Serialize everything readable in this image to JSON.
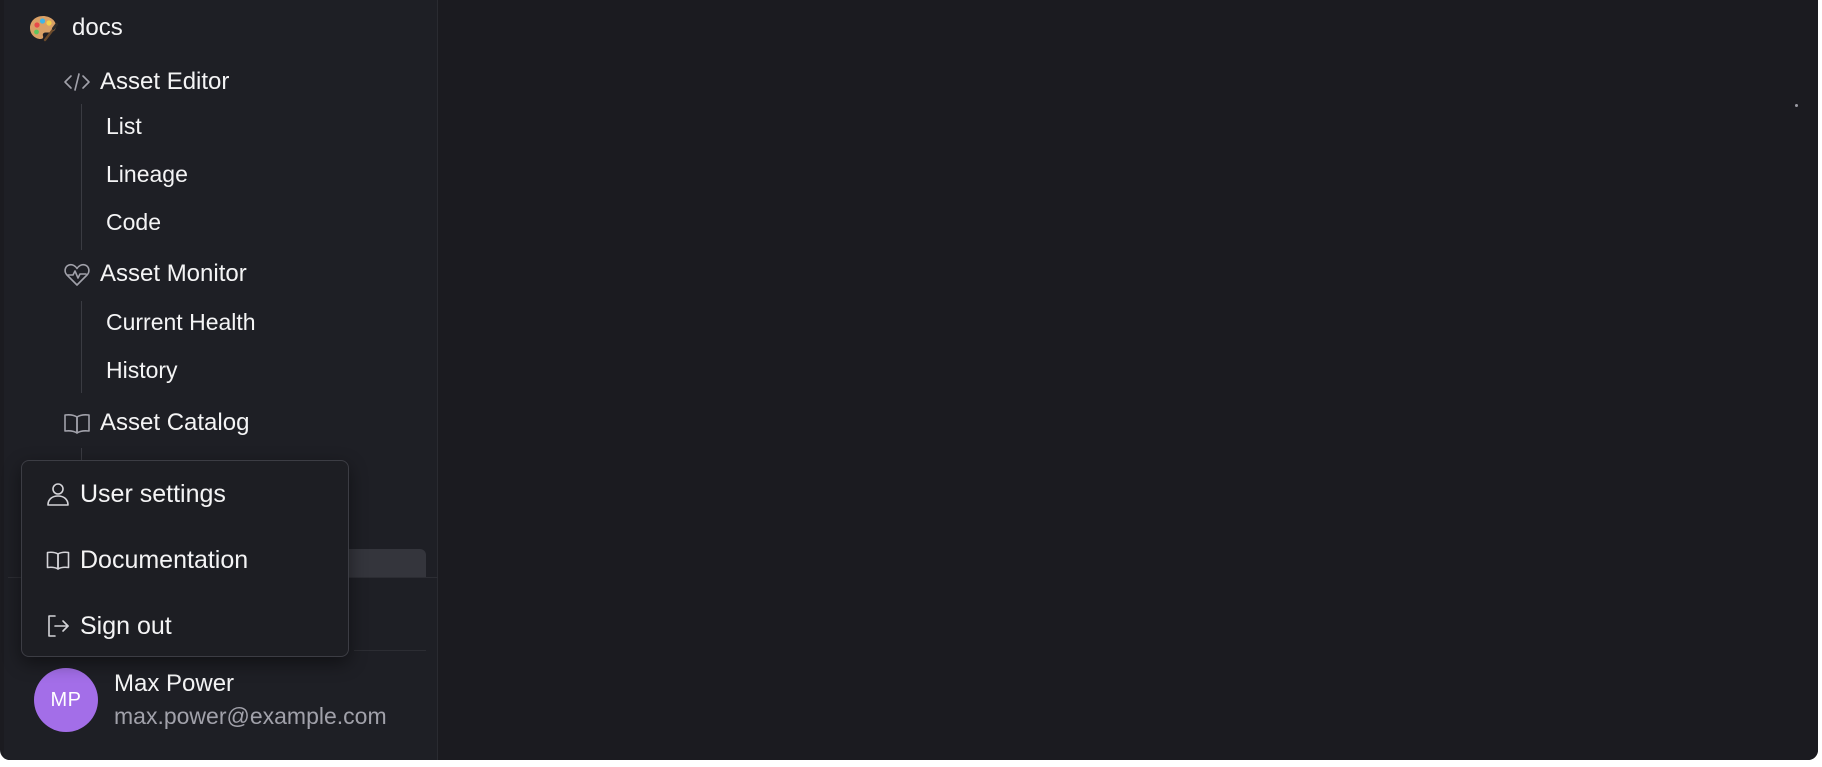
{
  "project": {
    "name": "docs",
    "icon": "palette-icon"
  },
  "nav": {
    "sections": [
      {
        "label": "Asset Editor",
        "icon": "code-icon",
        "items": [
          {
            "label": "List"
          },
          {
            "label": "Lineage"
          },
          {
            "label": "Code"
          }
        ]
      },
      {
        "label": "Asset Monitor",
        "icon": "heart-pulse-icon",
        "items": [
          {
            "label": "Current Health"
          },
          {
            "label": "History"
          }
        ]
      },
      {
        "label": "Asset Catalog",
        "icon": "book-open-icon",
        "items": []
      }
    ]
  },
  "user_menu": {
    "items": [
      {
        "label": "User settings",
        "icon": "user-icon"
      },
      {
        "label": "Documentation",
        "icon": "book-open-icon"
      },
      {
        "label": "Sign out",
        "icon": "sign-out-icon"
      }
    ]
  },
  "user": {
    "initials": "MP",
    "name": "Max Power",
    "email": "max.power@example.com"
  },
  "colors": {
    "background": "#1b1b20",
    "sidebar": "#1e1f25",
    "avatar": "#a36ee8",
    "text": "#f4f4f5",
    "muted_text": "#a1a1aa"
  }
}
